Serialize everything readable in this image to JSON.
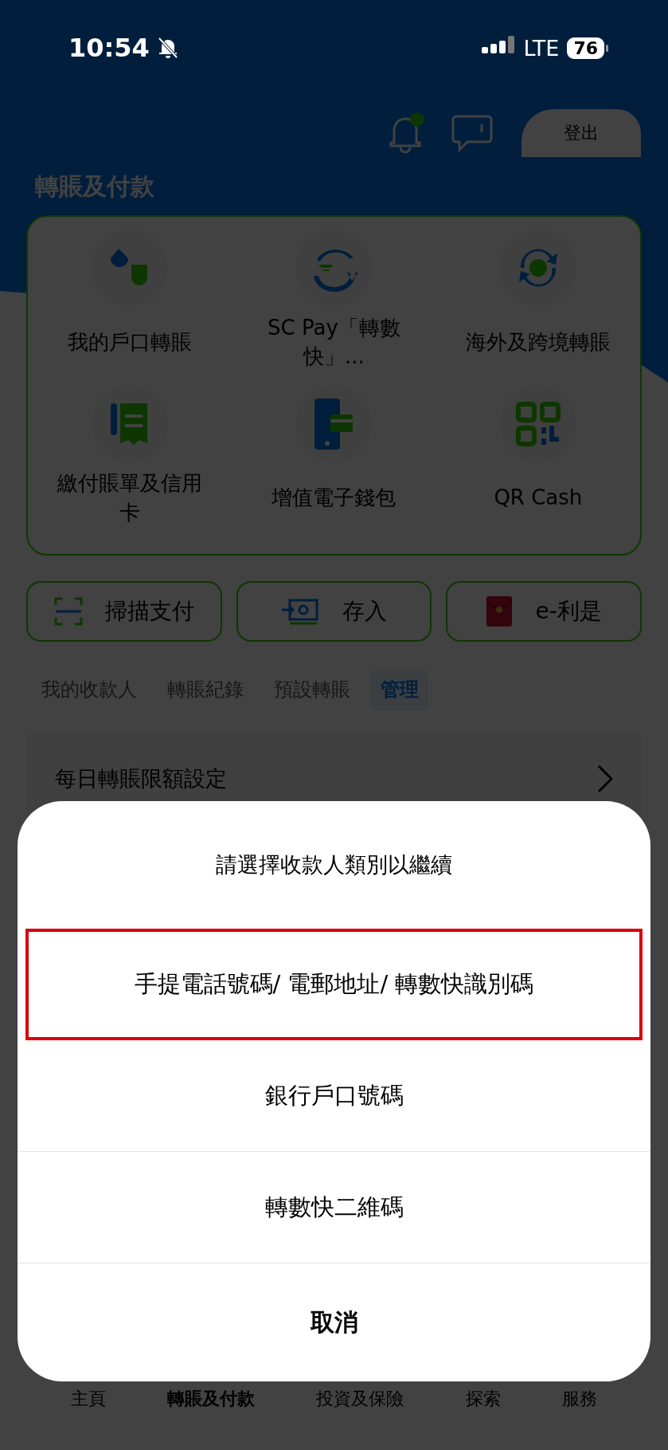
{
  "status_bar": {
    "time": "10:54",
    "network": "LTE",
    "battery": "76"
  },
  "header": {
    "notification_badge": true,
    "logout": "登出"
  },
  "section_title": "轉賬及付款",
  "services": [
    {
      "label": "我的戶口轉賬",
      "kind": "own"
    },
    {
      "label": "SC Pay「轉數快」...",
      "kind": "fps"
    },
    {
      "label": "海外及跨境轉賬",
      "kind": "overseas"
    },
    {
      "label": "繳付賬單及信用卡",
      "kind": "bill"
    },
    {
      "label": "增值電子錢包",
      "kind": "wallet"
    },
    {
      "label": "QR Cash",
      "kind": "qr"
    }
  ],
  "quick_actions": [
    {
      "label": "掃描支付",
      "kind": "scan"
    },
    {
      "label": "存入",
      "kind": "deposit"
    },
    {
      "label": "e-利是",
      "kind": "envelope"
    }
  ],
  "tabs": [
    {
      "label": "我的收款人",
      "selected": false
    },
    {
      "label": "轉賬紀錄",
      "selected": false
    },
    {
      "label": "預設轉賬",
      "selected": false
    },
    {
      "label": "管理",
      "selected": true
    }
  ],
  "settings_row": {
    "label": "每日轉賬限額設定"
  },
  "sheet": {
    "title": "請選擇收款人類別以繼續",
    "options": [
      {
        "label": "手提電話號碼/ 電郵地址/ 轉數快識別碼",
        "highlighted": true
      },
      {
        "label": "銀行戶口號碼",
        "highlighted": false
      },
      {
        "label": "轉數快二維碼",
        "highlighted": false
      }
    ],
    "cancel": "取消"
  },
  "bottom_nav": [
    {
      "label": "主頁",
      "selected": false
    },
    {
      "label": "轉賬及付款",
      "selected": true
    },
    {
      "label": "投資及保險",
      "selected": false
    },
    {
      "label": "探索",
      "selected": false
    },
    {
      "label": "服務",
      "selected": false
    }
  ]
}
